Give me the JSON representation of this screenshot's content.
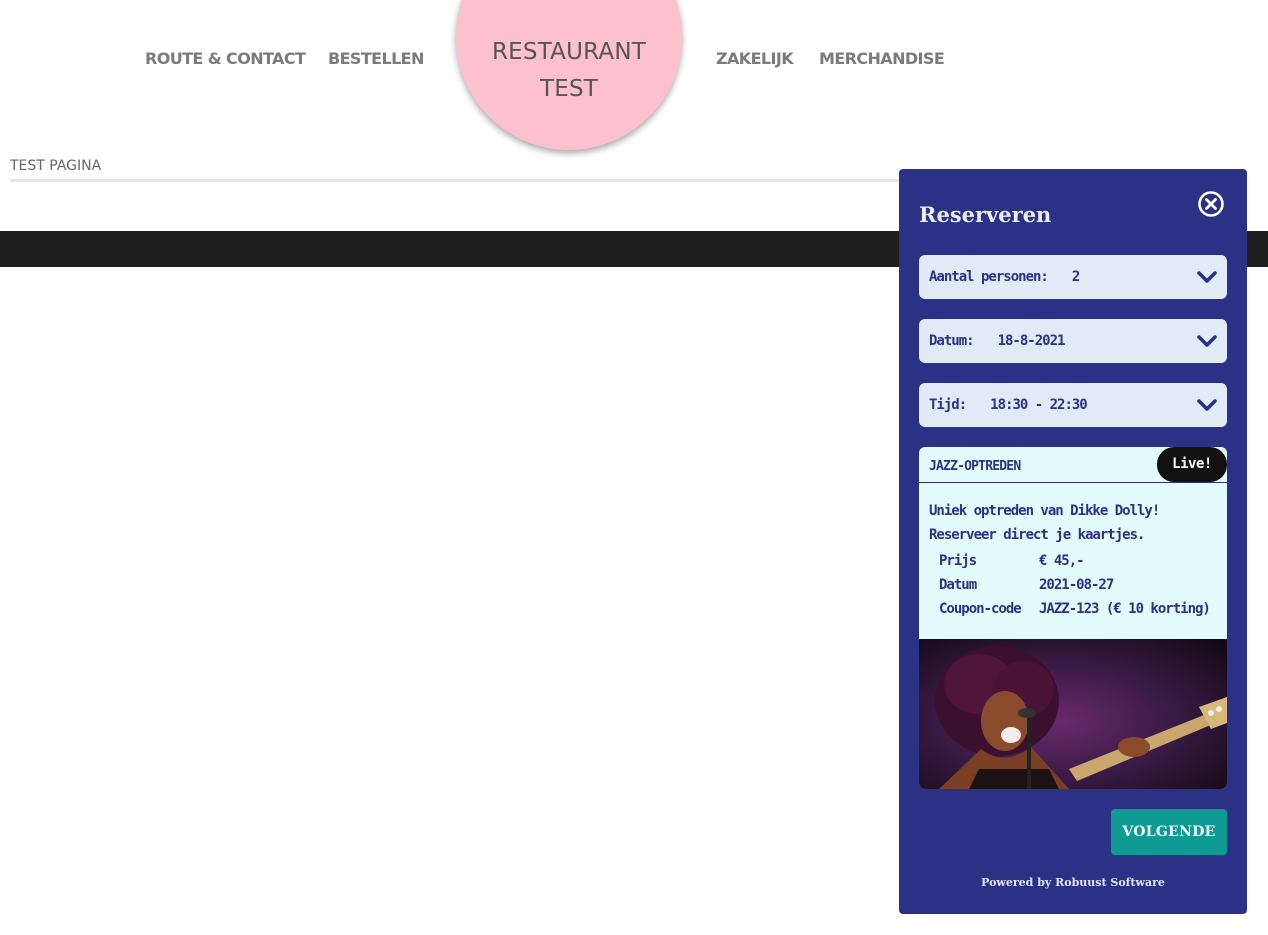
{
  "nav": {
    "route_contact": "ROUTE & CONTACT",
    "bestellen": "BESTELLEN",
    "zakelijk": "ZAKELIJK",
    "merchandise": "MERCHANDISE"
  },
  "logo": {
    "line1": "RESTAURANT",
    "line2": "TEST"
  },
  "page": {
    "title": "TEST PAGINA"
  },
  "colors": {
    "logo_bg": "#fdc0cd",
    "widget_bg": "#2b3286",
    "field_bg": "#e1eaf7",
    "card_bg": "#e3fbfd",
    "button_bg": "#0f9a93",
    "band_bg": "#1f1f1f"
  },
  "widget": {
    "title": "Reserveren",
    "close_icon": "close-circle-icon",
    "fields": {
      "persons": {
        "label": "Aantal personen:",
        "value": "2"
      },
      "date": {
        "label": "Datum:",
        "value": "18-8-2021"
      },
      "time": {
        "label": "Tijd:",
        "value": "18:30 - 22:30"
      }
    },
    "event": {
      "name": "JAZZ-OPTREDEN",
      "badge": "Live!",
      "description": "Uniek optreden van Dikke Dolly! Reserveer direct je kaartjes.",
      "details": [
        {
          "key": "Prijs",
          "value": "€ 45,-"
        },
        {
          "key": "Datum",
          "value": "2021-08-27"
        },
        {
          "key": "Coupon-code",
          "value": "JAZZ-123  (€ 10 korting)"
        }
      ]
    },
    "next_label": "VOLGENDE",
    "powered_by": "Powered by Robuust Software"
  }
}
